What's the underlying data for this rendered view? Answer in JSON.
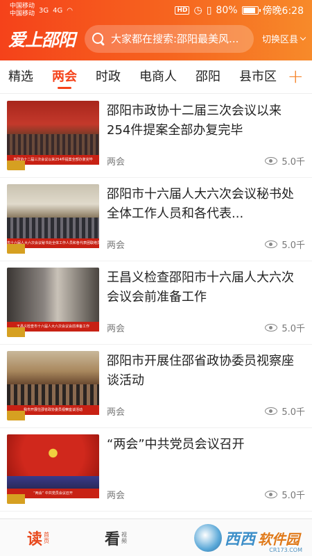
{
  "status_bar": {
    "carrier_1": "中国移动",
    "carrier_2": "中国移动",
    "signal_1": "3G",
    "signal_2": "4G",
    "battery": "80%",
    "time": "傍晚6:28"
  },
  "header": {
    "logo": "爱上邵阳",
    "search_placeholder": "大家都在搜索:邵阳最美风...",
    "region_label": "切换区县"
  },
  "tabs": [
    {
      "label": "精选",
      "active": false
    },
    {
      "label": "两会",
      "active": true
    },
    {
      "label": "时政",
      "active": false
    },
    {
      "label": "电商人",
      "active": false
    },
    {
      "label": "邵阳",
      "active": false
    },
    {
      "label": "县市区",
      "active": false
    }
  ],
  "news": [
    {
      "title": "邵阳市政协十二届三次会议以来254件提案全部办复完毕",
      "tag": "两会",
      "views": "5.0千",
      "caption": "市政协十二届三次会议以来254件提案全部办复完毕"
    },
    {
      "title": "邵阳市十六届人大六次会议秘书处全体工作人员和各代表...",
      "tag": "两会",
      "views": "5.0千",
      "caption": "市十六届人大六次会议秘书处全体工作人员和各代表团联络员会议召开"
    },
    {
      "title": "王昌义检查邵阳市十六届人大六次会议会前准备工作",
      "tag": "两会",
      "views": "5.0千",
      "caption": "王昌义检查市十六届人大六次会议会前准备工作"
    },
    {
      "title": "邵阳市开展住邵省政协委员视察座谈活动",
      "tag": "两会",
      "views": "5.0千",
      "caption": "我市开展住邵省政协委员视察座谈活动"
    },
    {
      "title": "“两会”中共党员会议召开",
      "tag": "两会",
      "views": "5.0千",
      "caption": "“两会” 中共党员会议召开"
    }
  ],
  "bottom_nav": {
    "read_big": "读",
    "read_small": "首页",
    "watch_big": "看",
    "watch_small": "视频",
    "watermark": "西西",
    "watermark_sub": "软件园",
    "watermark_url": "CR173.COM"
  }
}
